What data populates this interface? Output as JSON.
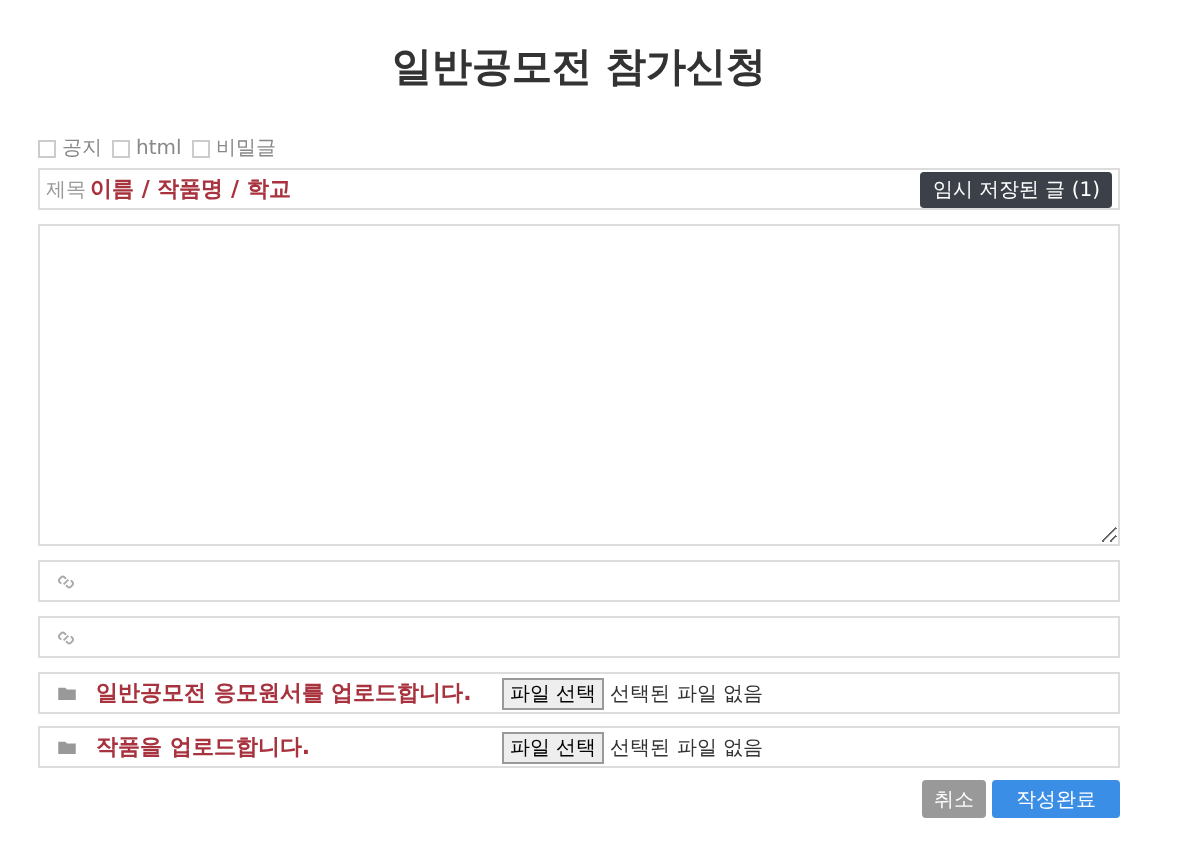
{
  "page_title": "일반공모전 참가신청",
  "options": [
    {
      "label": "공지",
      "checked": false
    },
    {
      "label": "html",
      "checked": false
    },
    {
      "label": "비밀글",
      "checked": false
    }
  ],
  "subject": {
    "label": "제목",
    "placeholder": "이름 / 작품명 / 학교",
    "draft_button": "임시 저장된 글 (1)"
  },
  "link_fields": [
    {
      "kind": "link"
    },
    {
      "kind": "link"
    }
  ],
  "file_rows": [
    {
      "label": "일반공모전 응모원서를 업로드합니다.",
      "button": "파일 선택",
      "status": "선택된 파일 없음"
    },
    {
      "label": "작품을 업로드합니다.",
      "button": "파일 선택",
      "status": "선택된 파일 없음"
    }
  ],
  "actions": [
    {
      "label": "취소",
      "kind": "cancel"
    },
    {
      "label": "작성완료",
      "kind": "submit"
    }
  ]
}
